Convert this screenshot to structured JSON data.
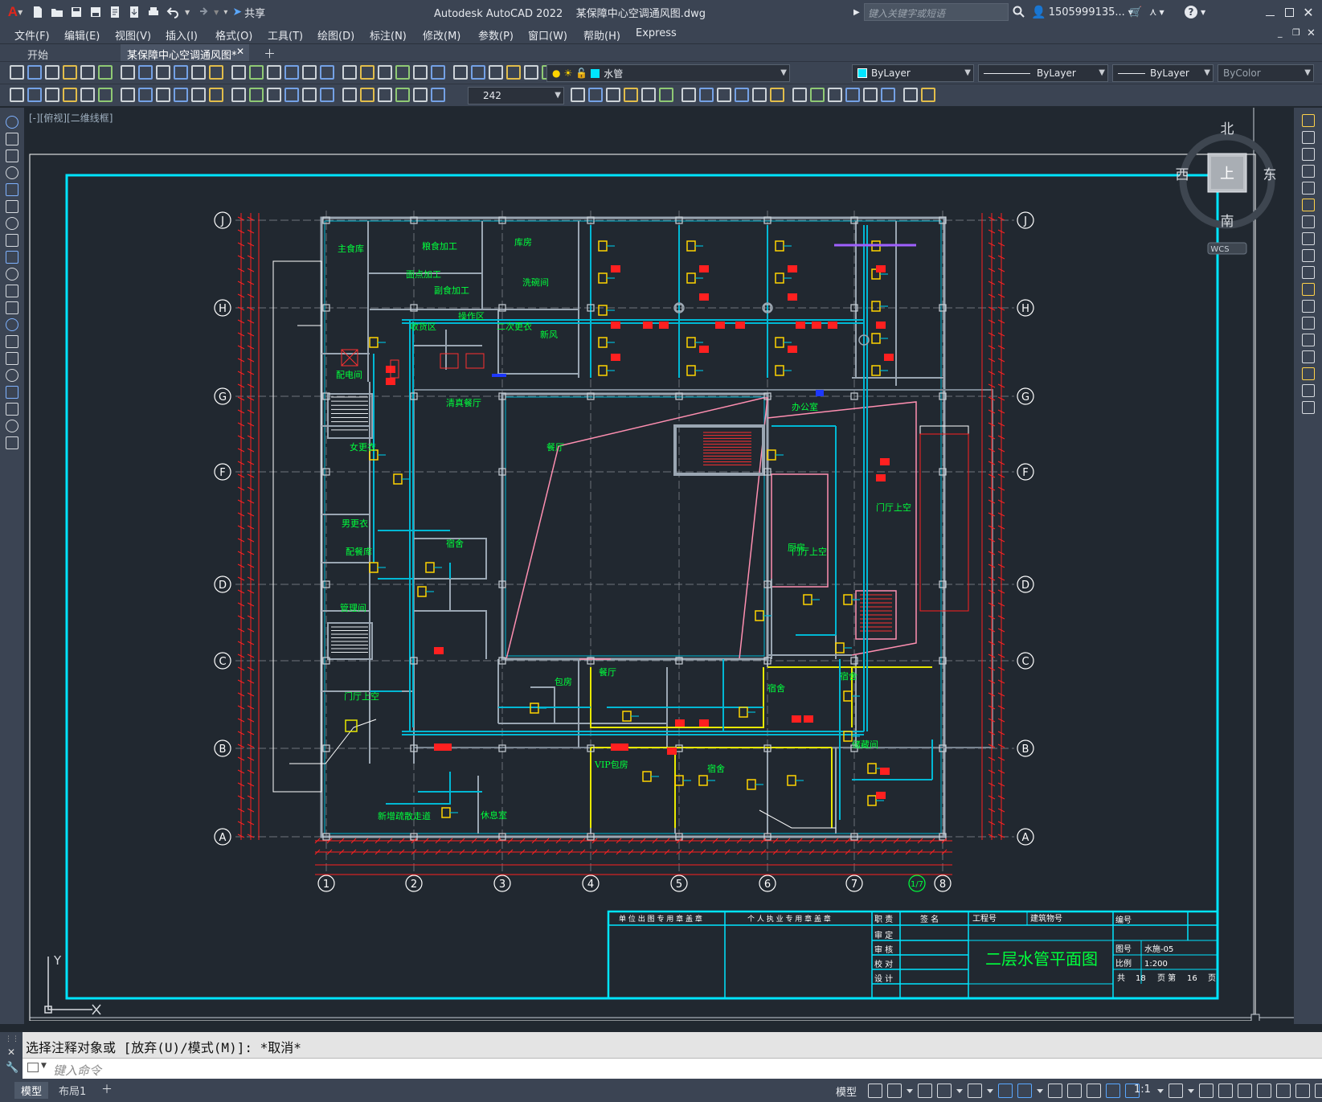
{
  "titlebar": {
    "app_title": "Autodesk AutoCAD 2022",
    "file_title": "某保障中心空调通风图.dwg",
    "share_label": "共享",
    "search_placeholder": "键入关键字或短语",
    "user": "1505999135...",
    "app_logo": "A"
  },
  "menu": [
    "文件(F)",
    "编辑(E)",
    "视图(V)",
    "插入(I)",
    "格式(O)",
    "工具(T)",
    "绘图(D)",
    "标注(N)",
    "修改(M)",
    "参数(P)",
    "窗口(W)",
    "帮助(H)",
    "Express"
  ],
  "tabs": [
    {
      "label": "开始"
    },
    {
      "label": "某保障中心空调通风图*"
    }
  ],
  "toolbar": {
    "layer_name": "水管",
    "color": "ByLayer",
    "linetype": "ByLayer",
    "lineweight": "ByLayer",
    "plotstyle": "ByColor",
    "dim_value": "242"
  },
  "view": {
    "label": "[-][俯视][二维线框]",
    "compass": {
      "north": "北",
      "south": "南",
      "east": "东",
      "west": "西",
      "top": "上",
      "wcs": "WCS"
    },
    "ucs_y": "Y"
  },
  "drawing": {
    "row_axes": [
      "J",
      "H",
      "G",
      "F",
      "D",
      "C",
      "B",
      "A"
    ],
    "col_axes": [
      "1",
      "2",
      "3",
      "4",
      "5",
      "6",
      "7",
      "8"
    ],
    "col_axis_extra": "1/7",
    "rooms": [
      "主食库",
      "粮食加工",
      "面点加工",
      "副食加工",
      "库房",
      "洗碗间",
      "操作区",
      "收货区",
      "二次更衣",
      "新风",
      "配电间",
      "女更衣",
      "男更衣",
      "配餐库",
      "管理间",
      "门厅上空",
      "办公室",
      "厨房",
      "宿舍",
      "清真餐厅",
      "包房",
      "餐厅",
      "VIP包房",
      "储藏间",
      "休息室",
      "新增疏散走道"
    ],
    "title_block": {
      "unit_seal": "单 位 出 图 专 用 章 盖 章",
      "personal_seal": "个 人 执 业 专 用 章 盖 章",
      "duty": "职 责",
      "signature": "签 名",
      "roles": [
        "审 定",
        "审 核",
        "校 对",
        "设 计"
      ],
      "project_no_label": "工程号",
      "building_no_label": "建筑物号",
      "drawing_title": "二层水管平面图",
      "number_label": "编号",
      "sheet_no_label": "图号",
      "sheet_no_value": "水施-05",
      "scale_label": "比例",
      "scale_value": "1:200",
      "total_label": "共",
      "total_value": "18",
      "page_label": "页  第",
      "page_value": "16",
      "page_suffix": "页"
    }
  },
  "command": {
    "history": "选择注释对象或 [放弃(U)/模式(M)]: *取消*",
    "placeholder": "键入命令"
  },
  "statusbar": {
    "layouts": [
      "模型",
      "布局1"
    ],
    "model_label": "模型",
    "scale": "1:1"
  },
  "colors": {
    "frame": "#00e5ff",
    "wall": "#9aa6b2",
    "pipe": "#00b8d4",
    "room_text": "#00ff3c",
    "equipment": "#ffd400",
    "valve": "#ff2020",
    "axis": "#ffffff",
    "stair": "#ff3030",
    "pink": "#ff8fb1"
  }
}
